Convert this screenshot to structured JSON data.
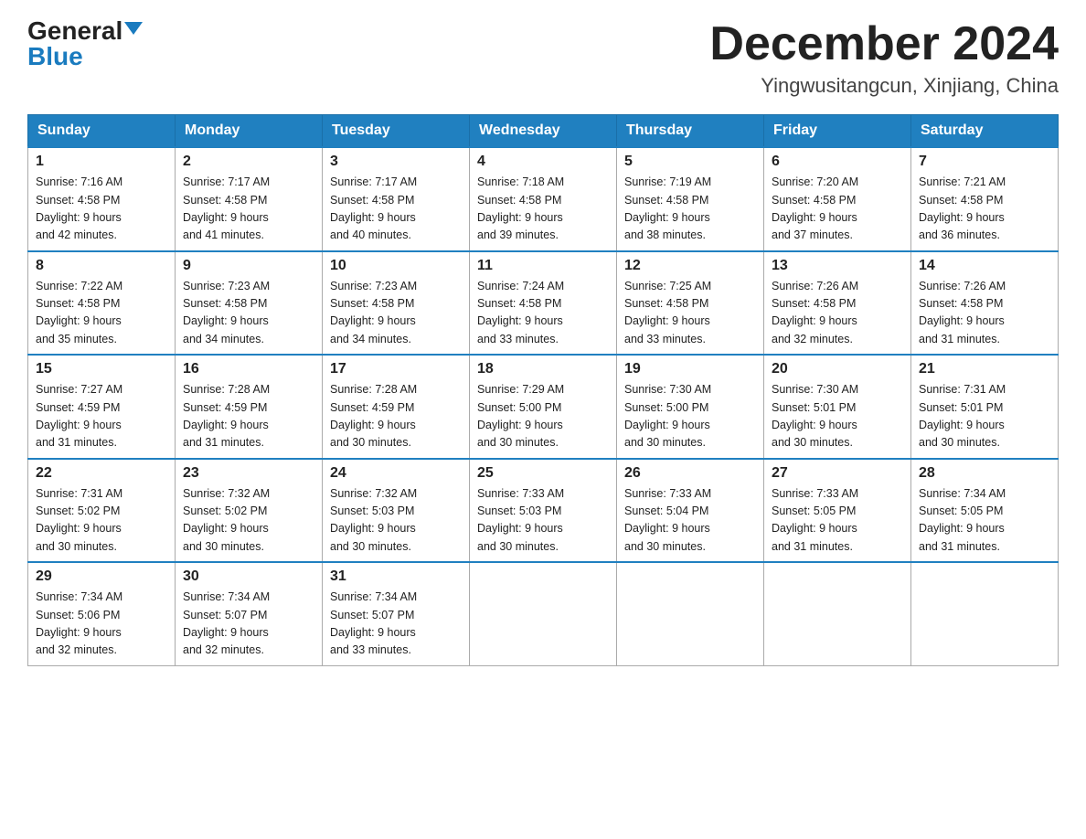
{
  "header": {
    "logo_general": "General",
    "logo_blue": "Blue",
    "month_title": "December 2024",
    "location": "Yingwusitangcun, Xinjiang, China"
  },
  "days_of_week": [
    "Sunday",
    "Monday",
    "Tuesday",
    "Wednesday",
    "Thursday",
    "Friday",
    "Saturday"
  ],
  "weeks": [
    [
      {
        "day": "1",
        "sunrise": "7:16 AM",
        "sunset": "4:58 PM",
        "daylight": "9 hours and 42 minutes."
      },
      {
        "day": "2",
        "sunrise": "7:17 AM",
        "sunset": "4:58 PM",
        "daylight": "9 hours and 41 minutes."
      },
      {
        "day": "3",
        "sunrise": "7:17 AM",
        "sunset": "4:58 PM",
        "daylight": "9 hours and 40 minutes."
      },
      {
        "day": "4",
        "sunrise": "7:18 AM",
        "sunset": "4:58 PM",
        "daylight": "9 hours and 39 minutes."
      },
      {
        "day": "5",
        "sunrise": "7:19 AM",
        "sunset": "4:58 PM",
        "daylight": "9 hours and 38 minutes."
      },
      {
        "day": "6",
        "sunrise": "7:20 AM",
        "sunset": "4:58 PM",
        "daylight": "9 hours and 37 minutes."
      },
      {
        "day": "7",
        "sunrise": "7:21 AM",
        "sunset": "4:58 PM",
        "daylight": "9 hours and 36 minutes."
      }
    ],
    [
      {
        "day": "8",
        "sunrise": "7:22 AM",
        "sunset": "4:58 PM",
        "daylight": "9 hours and 35 minutes."
      },
      {
        "day": "9",
        "sunrise": "7:23 AM",
        "sunset": "4:58 PM",
        "daylight": "9 hours and 34 minutes."
      },
      {
        "day": "10",
        "sunrise": "7:23 AM",
        "sunset": "4:58 PM",
        "daylight": "9 hours and 34 minutes."
      },
      {
        "day": "11",
        "sunrise": "7:24 AM",
        "sunset": "4:58 PM",
        "daylight": "9 hours and 33 minutes."
      },
      {
        "day": "12",
        "sunrise": "7:25 AM",
        "sunset": "4:58 PM",
        "daylight": "9 hours and 33 minutes."
      },
      {
        "day": "13",
        "sunrise": "7:26 AM",
        "sunset": "4:58 PM",
        "daylight": "9 hours and 32 minutes."
      },
      {
        "day": "14",
        "sunrise": "7:26 AM",
        "sunset": "4:58 PM",
        "daylight": "9 hours and 31 minutes."
      }
    ],
    [
      {
        "day": "15",
        "sunrise": "7:27 AM",
        "sunset": "4:59 PM",
        "daylight": "9 hours and 31 minutes."
      },
      {
        "day": "16",
        "sunrise": "7:28 AM",
        "sunset": "4:59 PM",
        "daylight": "9 hours and 31 minutes."
      },
      {
        "day": "17",
        "sunrise": "7:28 AM",
        "sunset": "4:59 PM",
        "daylight": "9 hours and 30 minutes."
      },
      {
        "day": "18",
        "sunrise": "7:29 AM",
        "sunset": "5:00 PM",
        "daylight": "9 hours and 30 minutes."
      },
      {
        "day": "19",
        "sunrise": "7:30 AM",
        "sunset": "5:00 PM",
        "daylight": "9 hours and 30 minutes."
      },
      {
        "day": "20",
        "sunrise": "7:30 AM",
        "sunset": "5:01 PM",
        "daylight": "9 hours and 30 minutes."
      },
      {
        "day": "21",
        "sunrise": "7:31 AM",
        "sunset": "5:01 PM",
        "daylight": "9 hours and 30 minutes."
      }
    ],
    [
      {
        "day": "22",
        "sunrise": "7:31 AM",
        "sunset": "5:02 PM",
        "daylight": "9 hours and 30 minutes."
      },
      {
        "day": "23",
        "sunrise": "7:32 AM",
        "sunset": "5:02 PM",
        "daylight": "9 hours and 30 minutes."
      },
      {
        "day": "24",
        "sunrise": "7:32 AM",
        "sunset": "5:03 PM",
        "daylight": "9 hours and 30 minutes."
      },
      {
        "day": "25",
        "sunrise": "7:33 AM",
        "sunset": "5:03 PM",
        "daylight": "9 hours and 30 minutes."
      },
      {
        "day": "26",
        "sunrise": "7:33 AM",
        "sunset": "5:04 PM",
        "daylight": "9 hours and 30 minutes."
      },
      {
        "day": "27",
        "sunrise": "7:33 AM",
        "sunset": "5:05 PM",
        "daylight": "9 hours and 31 minutes."
      },
      {
        "day": "28",
        "sunrise": "7:34 AM",
        "sunset": "5:05 PM",
        "daylight": "9 hours and 31 minutes."
      }
    ],
    [
      {
        "day": "29",
        "sunrise": "7:34 AM",
        "sunset": "5:06 PM",
        "daylight": "9 hours and 32 minutes."
      },
      {
        "day": "30",
        "sunrise": "7:34 AM",
        "sunset": "5:07 PM",
        "daylight": "9 hours and 32 minutes."
      },
      {
        "day": "31",
        "sunrise": "7:34 AM",
        "sunset": "5:07 PM",
        "daylight": "9 hours and 33 minutes."
      },
      null,
      null,
      null,
      null
    ]
  ]
}
